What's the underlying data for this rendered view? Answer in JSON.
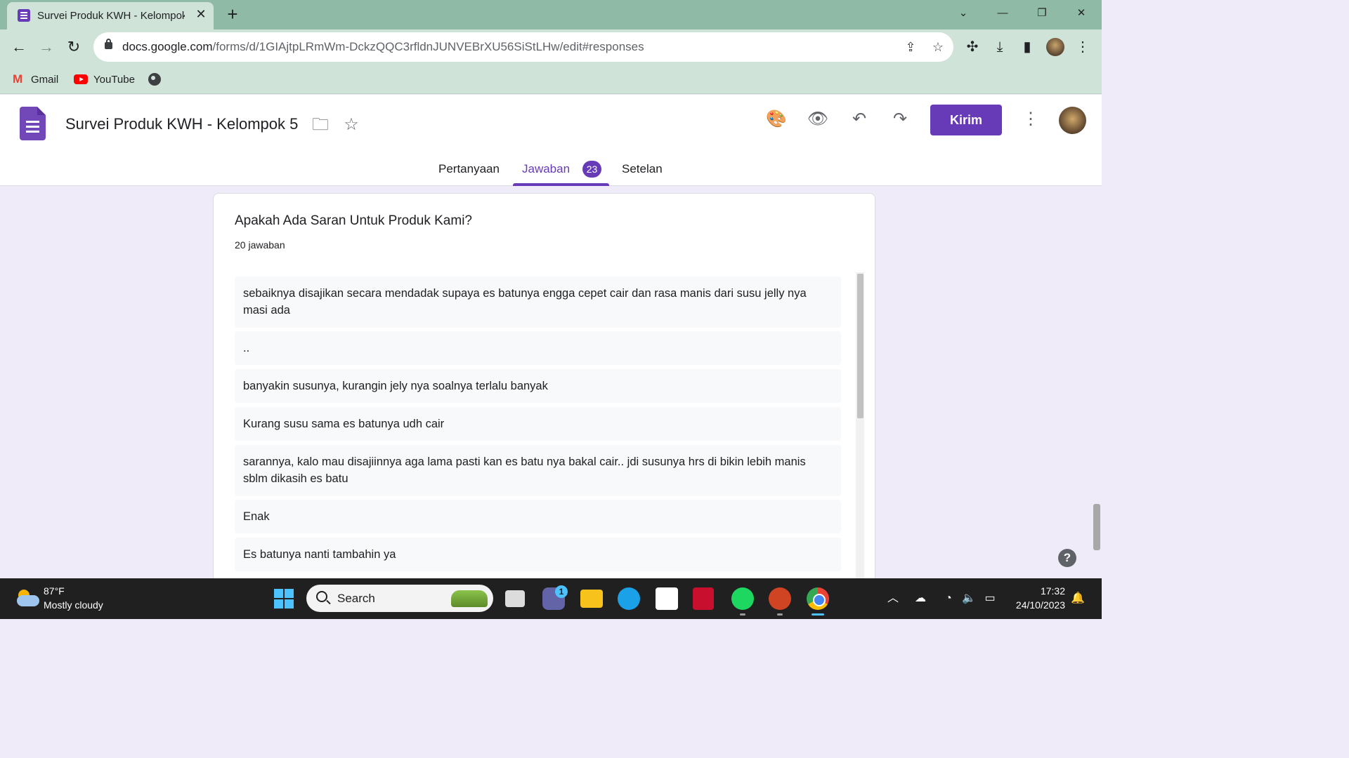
{
  "browser": {
    "tab_title": "Survei Produk KWH - Kelompok 5",
    "url_host": "docs.google.com",
    "url_path": "/forms/d/1GIAjtpLRmWm-DckzQQC3rfldnJUNVEBrXU56SiStLHw/edit#responses",
    "bookmarks": [
      {
        "label": "Gmail",
        "icon": "gmail-icon"
      },
      {
        "label": "YouTube",
        "icon": "youtube-icon"
      }
    ]
  },
  "forms": {
    "title": "Survei Produk KWH - Kelompok 5",
    "send_label": "Kirim",
    "tabs": {
      "questions": "Pertanyaan",
      "responses": "Jawaban",
      "settings": "Setelan"
    },
    "response_count": "23",
    "accent_color": "#673ab7"
  },
  "question": {
    "title": "Apakah Ada Saran Untuk Produk Kami?",
    "answer_count": "20 jawaban",
    "answers": [
      "sebaiknya disajikan secara mendadak supaya es batunya engga cepet cair dan rasa manis dari susu jelly nya masi ada",
      "..",
      "banyakin susunya, kurangin jely nya soalnya terlalu banyak",
      "Kurang susu sama es batunya udh cair",
      "sarannya, kalo mau disajiinnya aga lama pasti kan es batu nya bakal cair.. jdi susunya hrs di bikin lebih manis sblm dikasih es batu",
      "Enak",
      "Es batunya nanti tambahin ya"
    ]
  },
  "taskbar": {
    "weather_temp": "87°F",
    "weather_desc": "Mostly cloudy",
    "search_label": "Search",
    "chat_badge": "1",
    "time": "17:32",
    "date": "24/10/2023"
  }
}
